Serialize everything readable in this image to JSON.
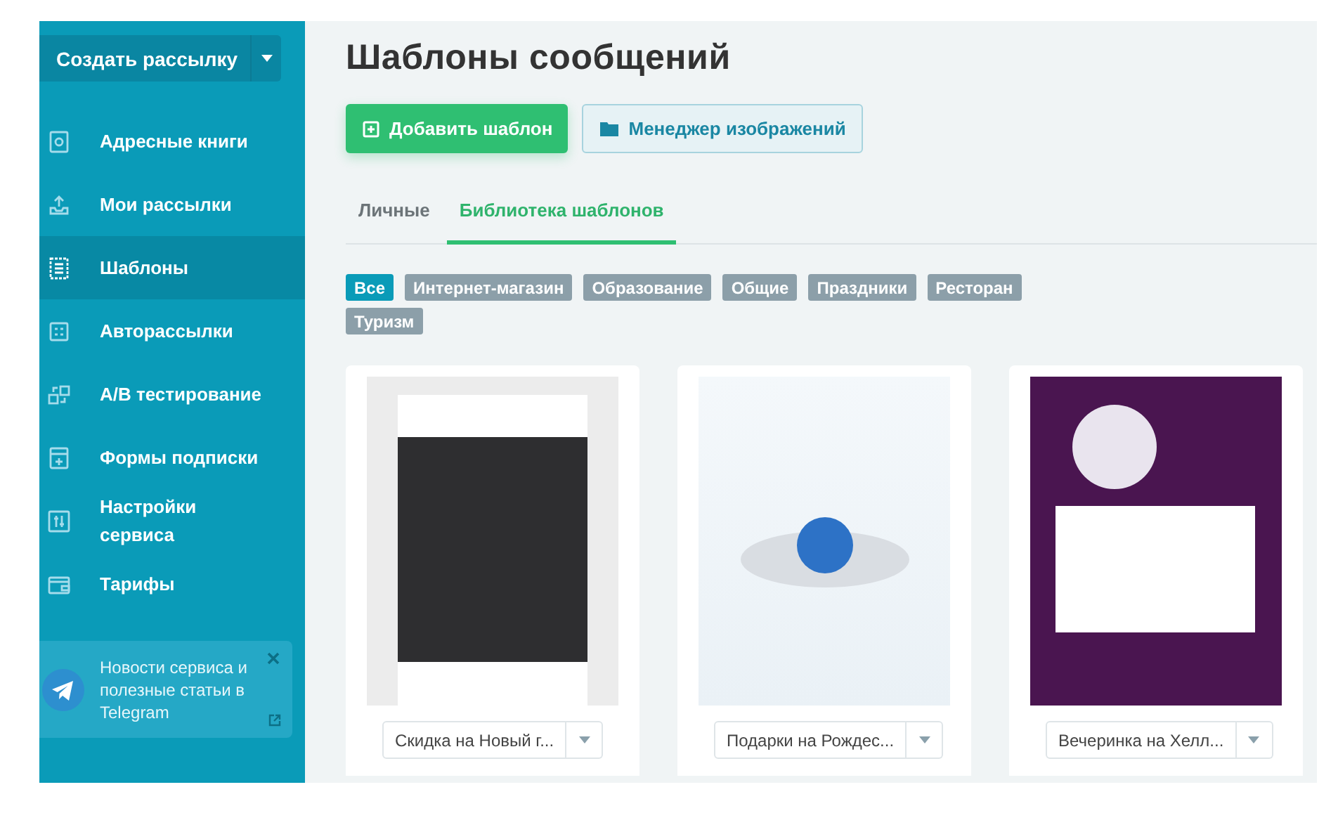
{
  "sidebar": {
    "create_button": {
      "label": "Создать рассылку"
    },
    "items": [
      {
        "label": "Адресные книги",
        "selected": false
      },
      {
        "label": "Мои рассылки",
        "selected": false
      },
      {
        "label": "Шаблоны",
        "selected": true
      },
      {
        "label": "Авторассылки",
        "selected": false
      },
      {
        "label": "A/B тестирование",
        "selected": false
      },
      {
        "label": "Формы подписки",
        "selected": false
      },
      {
        "label": "Настройки сервиса",
        "selected": false
      },
      {
        "label": "Тарифы",
        "selected": false
      }
    ],
    "telegram_banner": {
      "text": "Новости сервиса и полезные статьи в Telegram"
    }
  },
  "main": {
    "title": "Шаблоны сообщений",
    "buttons": [
      {
        "label": "Добавить шаблон",
        "kind": "primary"
      },
      {
        "label": "Менеджер изображений",
        "kind": "secondary"
      }
    ],
    "tabs": [
      {
        "label": "Личные",
        "selected": false
      },
      {
        "label": "Библиотека шаблонов",
        "selected": true
      }
    ],
    "filters": [
      {
        "label": "Все",
        "selected": true
      },
      {
        "label": "Интернет-магазин",
        "selected": false
      },
      {
        "label": "Образование",
        "selected": false
      },
      {
        "label": "Общие",
        "selected": false
      },
      {
        "label": "Праздники",
        "selected": false
      },
      {
        "label": "Ресторан",
        "selected": false
      },
      {
        "label": "Туризм",
        "selected": false
      }
    ],
    "templates": [
      {
        "name": "Скидка на Новый г...",
        "kind": "new-year"
      },
      {
        "name": "Подарки на Рождес...",
        "kind": "christmas"
      },
      {
        "name": "Вечеринка на Хелл...",
        "kind": "halloween"
      }
    ]
  }
}
